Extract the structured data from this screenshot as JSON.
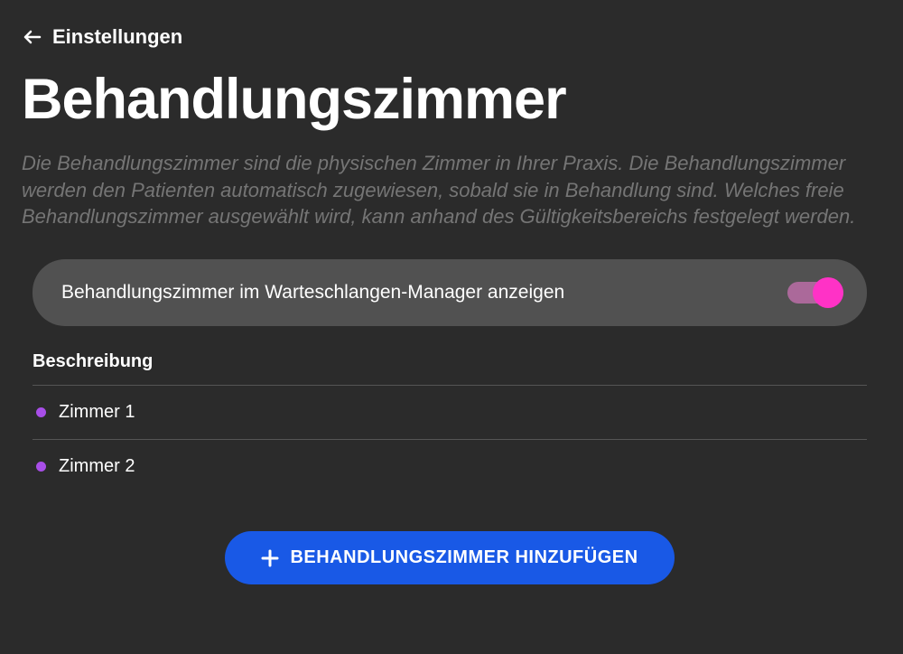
{
  "breadcrumb": {
    "label": "Einstellungen"
  },
  "page": {
    "title": "Behandlungszimmer",
    "description": "Die Behandlungszimmer sind die physischen Zimmer in Ihrer Praxis. Die Behandlungszimmer werden den Patienten automatisch zugewiesen, sobald sie in Behandlung sind. Welches freie Behandlungszimmer ausgewählt wird, kann anhand des Gültigkeitsbereichs festgelegt werden."
  },
  "toggle": {
    "label": "Behandlungszimmer im Warteschlangen-Manager anzeigen",
    "enabled": true
  },
  "table": {
    "header": "Beschreibung",
    "rows": [
      {
        "label": "Zimmer 1"
      },
      {
        "label": "Zimmer 2"
      }
    ]
  },
  "actions": {
    "add_button_label": "BEHANDLUNGSZIMMER HINZUFÜGEN"
  },
  "colors": {
    "accent_blue": "#1959e6",
    "accent_pink": "#ff32c6",
    "row_dot": "#a84ee8"
  }
}
